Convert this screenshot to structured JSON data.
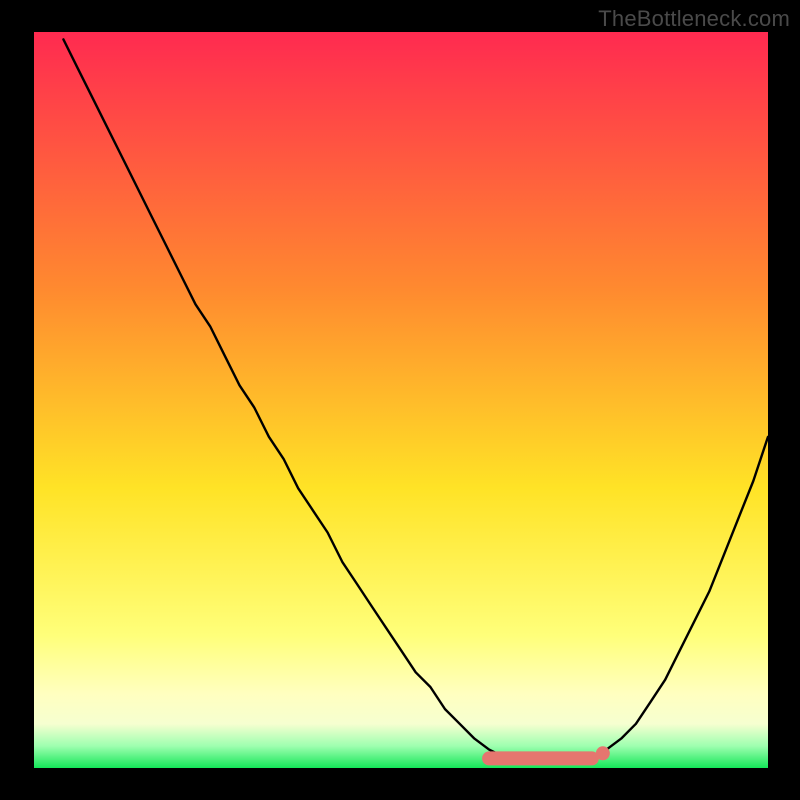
{
  "watermark": "TheBottleneck.com",
  "colors": {
    "gradient_top": "#ff2a50",
    "gradient_mid_upper": "#ff8a2f",
    "gradient_mid": "#ffe326",
    "gradient_lower": "#ffff7a",
    "gradient_pale": "#f6ffd0",
    "gradient_bottom": "#14e759",
    "curve_stroke": "#000000",
    "marker_fill": "#e5766f",
    "frame_bg": "#000000"
  },
  "chart_data": {
    "type": "line",
    "title": "",
    "xlabel": "",
    "ylabel": "",
    "xlim": [
      0,
      100
    ],
    "ylim": [
      0,
      100
    ],
    "series": [
      {
        "name": "bottleneck-curve",
        "x": [
          4,
          6,
          8,
          10,
          12,
          14,
          16,
          18,
          20,
          22,
          24,
          26,
          28,
          30,
          32,
          34,
          36,
          38,
          40,
          42,
          44,
          46,
          48,
          50,
          52,
          54,
          56,
          58,
          60,
          62,
          64,
          66,
          68,
          70,
          72,
          74,
          76,
          78,
          80,
          82,
          84,
          86,
          88,
          90,
          92,
          94,
          96,
          98,
          100
        ],
        "y": [
          99,
          95,
          91,
          87,
          83,
          79,
          75,
          71,
          67,
          63,
          60,
          56,
          52,
          49,
          45,
          42,
          38,
          35,
          32,
          28,
          25,
          22,
          19,
          16,
          13,
          11,
          8,
          6,
          4,
          2.5,
          1.5,
          1,
          1,
          1,
          1,
          1,
          1.5,
          2.5,
          4,
          6,
          9,
          12,
          16,
          20,
          24,
          29,
          34,
          39,
          45
        ]
      }
    ],
    "markers": [
      {
        "name": "sweet-spot-range",
        "x_start": 62,
        "x_end": 76,
        "y": 1.3
      },
      {
        "name": "sweet-spot-point",
        "x": 77.5,
        "y": 2
      }
    ],
    "gradient_bands_pct_from_top": [
      0,
      35,
      62,
      82,
      90,
      94,
      97,
      100
    ]
  }
}
